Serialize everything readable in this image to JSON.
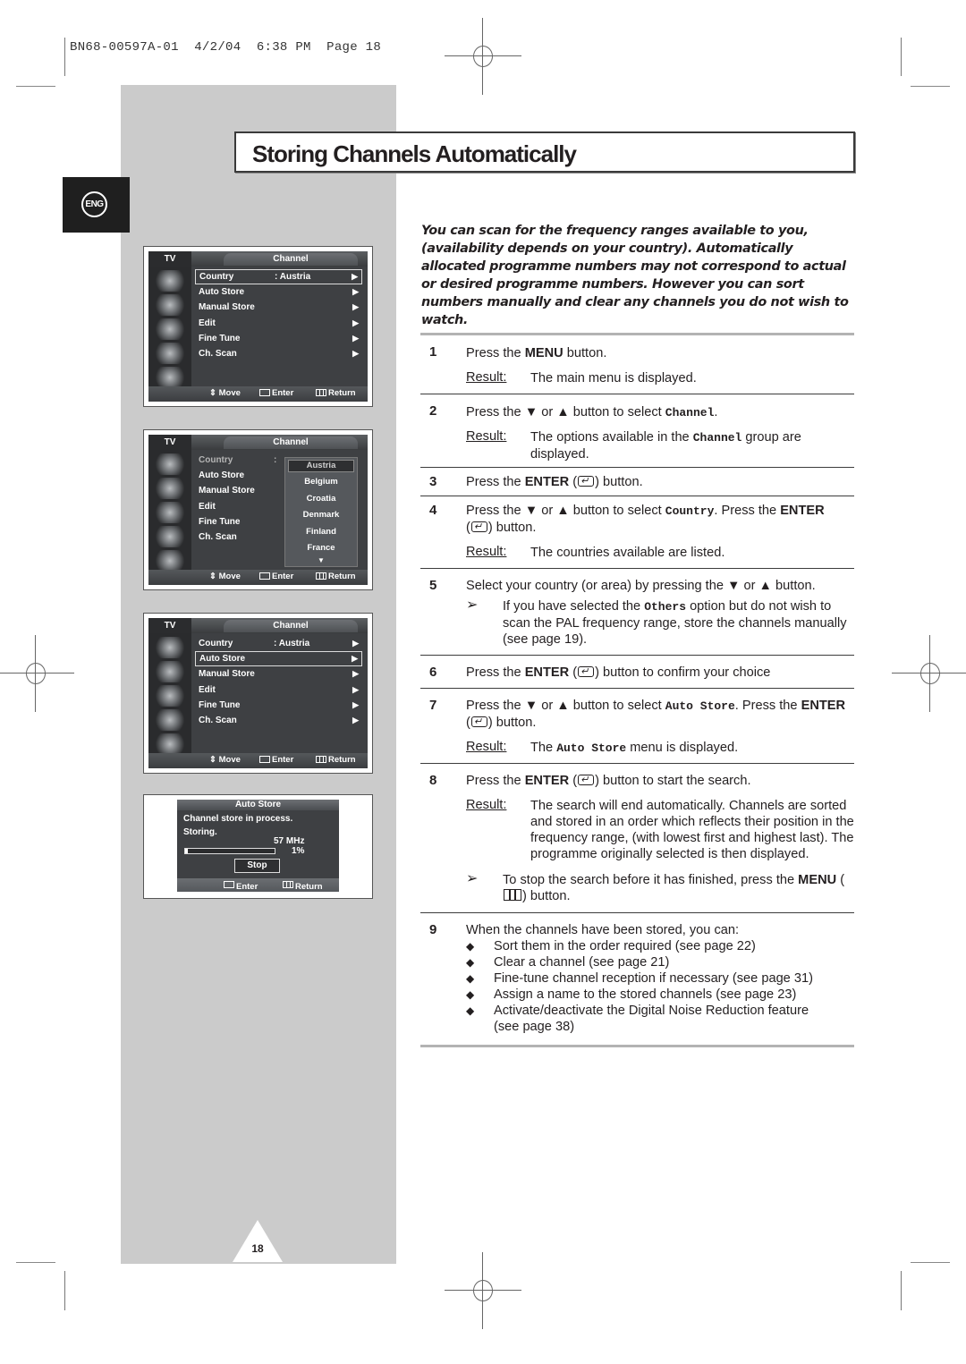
{
  "slug": "BN68-00597A-01  4/2/04  6:38 PM  Page 18",
  "language_badge": "ENG",
  "title": "Storing Channels Automatically",
  "intro": "You can scan for the frequency ranges available to you, (availability depends on your country). Automatically allocated programme numbers may not correspond to actual or desired programme numbers. However you can sort numbers manually and clear any channels you do not wish to watch.",
  "osd": {
    "tv_label": "TV",
    "menu_title": "Channel",
    "items": [
      {
        "label": "Country",
        "value": ": Austria"
      },
      {
        "label": "Auto Store",
        "value": ""
      },
      {
        "label": "Manual Store",
        "value": ""
      },
      {
        "label": "Edit",
        "value": ""
      },
      {
        "label": "Fine Tune",
        "value": ""
      },
      {
        "label": "Ch. Scan",
        "value": ""
      }
    ],
    "arrow": "▶",
    "footer": {
      "move": "Move",
      "enter": "Enter",
      "return": "Return"
    },
    "country_colon": ":",
    "countries": [
      "Austria",
      "Belgium",
      "Croatia",
      "Denmark",
      "Finland",
      "France"
    ],
    "more_arrow": "▼",
    "screen1_selected": "Country",
    "screen3_selected": "Auto Store"
  },
  "auto_store": {
    "title": "Auto Store",
    "line1": "Channel store in process.",
    "line2": "Storing.",
    "frequency": "57 MHz",
    "progress_label": "1%",
    "progress": 0.01,
    "stop_label": "Stop",
    "enter_label": "Enter",
    "return_label": "Return"
  },
  "steps": {
    "result_label": "Result:",
    "s1": {
      "num": "1",
      "pre": "Press the ",
      "key": "MENU",
      "post": " button.",
      "result": "The main menu is displayed."
    },
    "s2": {
      "num": "2",
      "pre": "Press the ▼ or ▲ button to select ",
      "code": "Channel",
      "post": ".",
      "result_pre": "The options available in the ",
      "result_code": "Channel",
      "result_post": " group are displayed."
    },
    "s3": {
      "num": "3",
      "pre": "Press the ",
      "key": "ENTER",
      "post": " button."
    },
    "s4": {
      "num": "4",
      "pre": "Press the ▼ or ▲ button to select ",
      "code": "Country",
      "mid": ". Press the ",
      "key": "ENTER",
      "post": " button.",
      "result": "The countries available are listed."
    },
    "s5": {
      "num": "5",
      "text": "Select your country (or area) by pressing the ▼ or ▲ button.",
      "note_pre": "If you have selected the ",
      "note_code": "Others",
      "note_post": " option but do not wish to scan the PAL frequency range, store the channels manually (see page 19)."
    },
    "s6": {
      "num": "6",
      "pre": "Press the ",
      "key": "ENTER",
      "post": " button to confirm your choice"
    },
    "s7": {
      "num": "7",
      "pre": "Press the ▼ or ▲ button to select ",
      "code": "Auto Store",
      "mid": ". Press the ",
      "key": "ENTER",
      "post": " button.",
      "result_pre": "The ",
      "result_code": "Auto Store",
      "result_post": " menu is displayed."
    },
    "s8": {
      "num": "8",
      "pre": "Press the ",
      "key": "ENTER",
      "post": " button to start the search.",
      "result": "The search will end automatically. Channels are sorted and stored in an order which reflects their position in the frequency range, (with lowest first and highest last). The programme originally selected is then displayed.",
      "note_pre": "To stop the search before it has finished, press the ",
      "note_key": "MENU",
      "note_post": " button."
    },
    "s9": {
      "num": "9",
      "text": "When the channels have been stored, you can:",
      "bullets": [
        "Sort them in the order required (see page 22)",
        "Clear a channel (see page 21)",
        "Fine-tune channel reception if necessary (see page 31)",
        "Assign a name to the stored channels (see page 23)",
        "Activate/deactivate the Digital Noise Reduction feature",
        "(see page 38)"
      ]
    }
  },
  "note_arrow": "➢",
  "bullet_glyph": "◆",
  "page_number": "18"
}
